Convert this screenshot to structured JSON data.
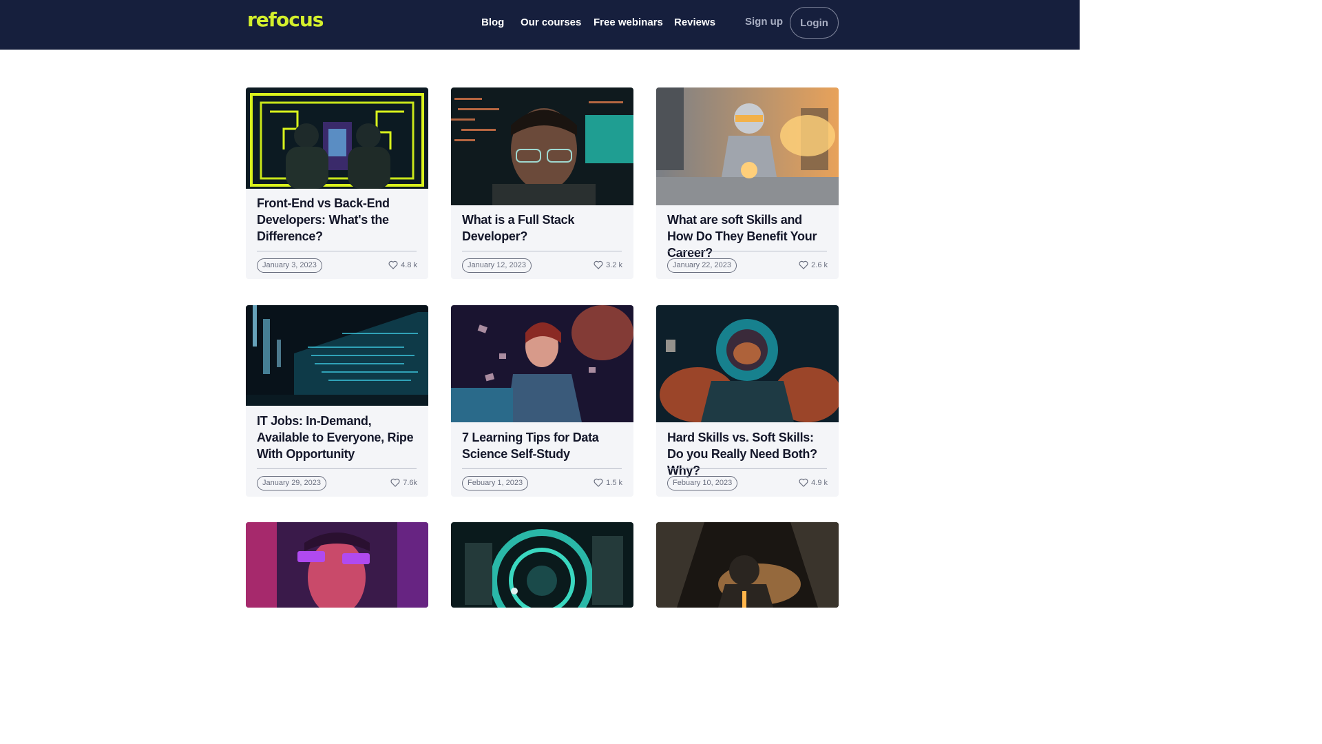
{
  "header": {
    "logo": "refocus",
    "nav": [
      "Blog",
      "Our courses",
      "Free webinars",
      "Reviews"
    ],
    "signup": "Sign up",
    "login": "Login"
  },
  "colors": {
    "nav_bg": "#161f3d",
    "brand": "#d4ef2c",
    "card_bg": "#f4f5f8"
  },
  "posts": [
    {
      "title": "Front-End vs Back-End Developers: What's the Difference?",
      "date": "January 3, 2023",
      "likes": "4.8 k",
      "image": "two people facing neon yellow maze"
    },
    {
      "title": "What is a Full Stack Developer?",
      "date": "January 12, 2023",
      "likes": "3.2 k",
      "image": "developer with glasses lit by code"
    },
    {
      "title": "What are soft Skills and How Do They Benefit Your Career?",
      "date": "January 22, 2023",
      "likes": "2.6 k",
      "image": "robot rider on motorbike in city"
    },
    {
      "title": "IT Jobs: In-Demand, Available to Everyone, Ripe With Opportunity",
      "date": "January 29, 2023",
      "likes": "7.6k",
      "image": "cyan digital data skyline"
    },
    {
      "title": "7 Learning Tips for Data Science Self-Study",
      "date": "Febuary 1, 2023",
      "likes": "1.5 k",
      "image": "cyborg woman with laptop"
    },
    {
      "title": "Hard Skills vs. Soft Skills: Do you Really Need Both? Why?",
      "date": "Febuary 10, 2023",
      "likes": "4.9 k",
      "image": "astronaut in glowing space suit"
    },
    {
      "title": "",
      "date": "",
      "likes": "",
      "image": "woman with neon glasses"
    },
    {
      "title": "",
      "date": "",
      "likes": "",
      "image": "teal mechanical gear machine"
    },
    {
      "title": "",
      "date": "",
      "likes": "",
      "image": "figure silhouetted in corridor"
    }
  ]
}
